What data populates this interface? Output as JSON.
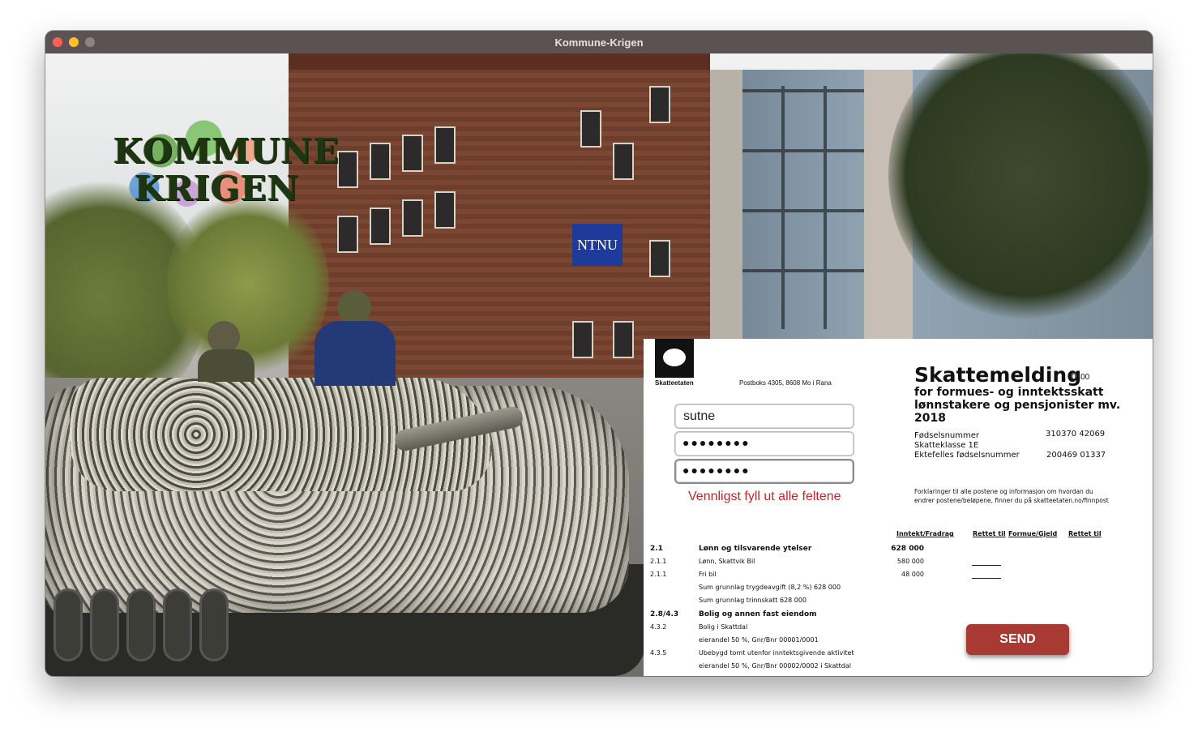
{
  "window": {
    "title": "Kommune-Krigen"
  },
  "logo": {
    "line1": "KOMMUNE",
    "line2": "KRIGEN"
  },
  "background": {
    "sign_text": "NTNU"
  },
  "form": {
    "logo_label": "Skatteetaten",
    "postbox": "Postboks 4305, 8608 Mo i Rana",
    "title": "Skattemelding",
    "code": "0400",
    "subtitle1": "for formues- og inntektsskatt",
    "subtitle2": "lønnstakere og pensjonister mv. 2018",
    "info": [
      {
        "label": "Fødselsnummer",
        "value": "310370 42069"
      },
      {
        "label": "Skatteklasse  1E",
        "value": ""
      },
      {
        "label": "Ektefelles fødselsnummer",
        "value": "200469 01337"
      }
    ],
    "note_line1": "Forklaringer til alle postene og informasjon om hvordan du",
    "note_line2": "endrer postene/beløpene, finner du på skatteetaten.no/finnpost",
    "columns": [
      "Inntekt/Fradrag",
      "Rettet til",
      "Formue/Gjeld",
      "Rettet til"
    ],
    "rows": [
      {
        "code": "2.1",
        "text": "Lønn og tilsvarende ytelser",
        "value": "628 000",
        "bold": true
      },
      {
        "code": "2.1.1",
        "text": "Lønn, Skattvik Bil",
        "value": "580 000"
      },
      {
        "code": "2.1.1",
        "text": "Fri bil",
        "value": "48 000"
      },
      {
        "code": "",
        "text": "Sum grunnlag trygdeavgift (8,2 %)    628 000",
        "value": ""
      },
      {
        "code": "",
        "text": "Sum grunnlag trinnskatt  628 000",
        "value": ""
      },
      {
        "code": "2.8/4.3",
        "text": "Bolig og annen fast eiendom",
        "value": "",
        "bold": true
      },
      {
        "code": "4.3.2",
        "text": "Bolig i Skattdal",
        "value": ""
      },
      {
        "code": "",
        "text": "eierandel 50 %, Gnr/Bnr 00001/0001",
        "value": ""
      },
      {
        "code": "4.3.5",
        "text": "Ubebygd tomt utenfor inntektsgivende aktivitet",
        "value": ""
      },
      {
        "code": "",
        "text": "eierandel 50 %, Gnr/Bnr 00002/0002 i Skattdal",
        "value": ""
      }
    ],
    "username_value": "sutne",
    "password_dots": "●●●●●●●●",
    "password_confirm_dots": "●●●●●●●●",
    "error_text": "Vennligst fyll ut alle feltene",
    "send_label": "SEND"
  }
}
